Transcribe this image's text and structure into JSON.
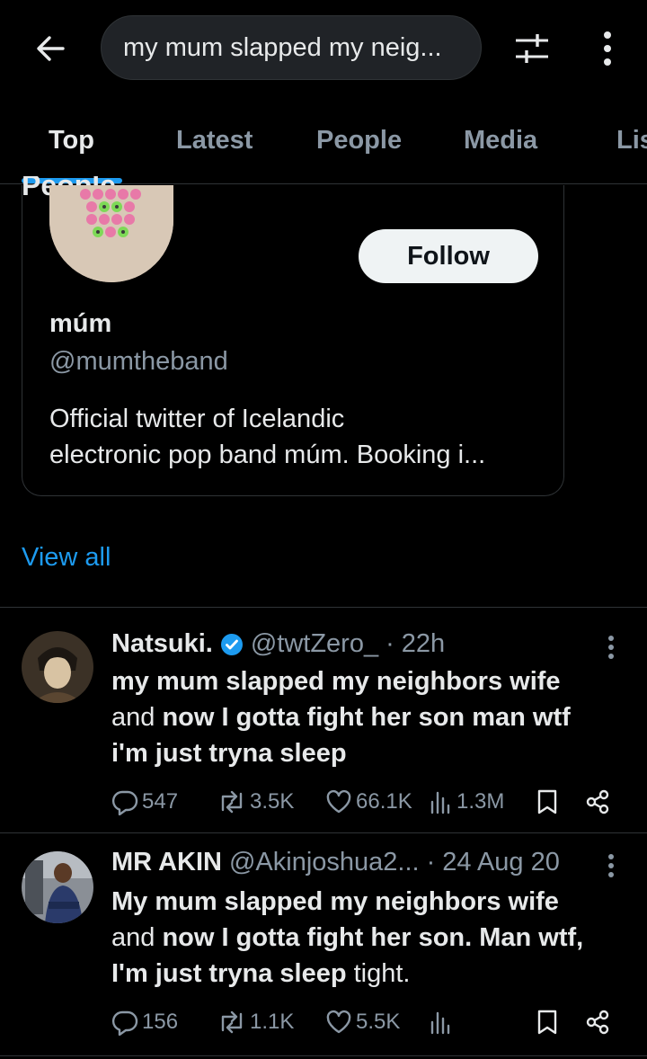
{
  "search": {
    "query": "my mum slapped my neig..."
  },
  "tabs": [
    {
      "label": "Top"
    },
    {
      "label": "Latest"
    },
    {
      "label": "People"
    },
    {
      "label": "Media"
    },
    {
      "label": "Lis"
    }
  ],
  "people_section": {
    "heading": "People",
    "user": {
      "name": "múm",
      "handle": "@mumtheband",
      "bio_line1": "Official twitter of Icelandic",
      "bio_line2": "electronic pop band múm.  Booking i...",
      "follow_label": "Follow"
    },
    "view_all": "View all"
  },
  "tweets": [
    {
      "name": "Natsuki.",
      "verified": true,
      "handle": "@twtZero_",
      "dot": "·",
      "time": "22h",
      "text_l1": "my mum slapped my neighbors wife",
      "text_l2_a": "and ",
      "text_l2_b": "now I gotta fight her son man wtf",
      "text_l3": "i'm just tryna sleep",
      "replies": "547",
      "retweets": "3.5K",
      "likes": "66.1K",
      "views": "1.3M"
    },
    {
      "name": "MR AKIN",
      "handle": "@Akinjoshua2...",
      "dot": "·",
      "time": "24 Aug 20",
      "text_l1": "My mum slapped my neighbors wife",
      "text_l2_a": "and ",
      "text_l2_b": "now I gotta fight her son. Man wtf,",
      "text_l3_a": "I'm just tryna sleep",
      "text_l3_b": " tight.",
      "replies": "156",
      "retweets": "1.1K",
      "likes": "5.5K",
      "views": ""
    }
  ],
  "colors": {
    "accent": "#1d9bf0",
    "muted": "#8b98a5",
    "text": "#e7e9ea",
    "bg": "#000000"
  }
}
